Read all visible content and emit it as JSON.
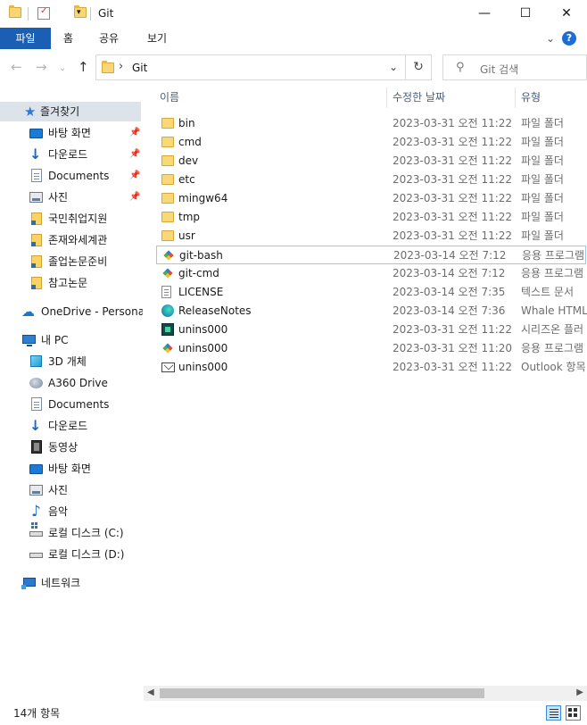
{
  "window": {
    "title": "Git",
    "minimize": "—",
    "maximize": "☐",
    "close": "✕"
  },
  "ribbon": {
    "tabs": [
      "파일",
      "홈",
      "공유",
      "보기"
    ],
    "help": "?"
  },
  "address": {
    "separator": "›",
    "path": "Git",
    "dropdown": "⌄",
    "refresh": "↻"
  },
  "search": {
    "placeholder": "Git 검색"
  },
  "nav": {
    "back": "←",
    "forward": "→",
    "recent": "⌄",
    "up": "↑",
    "quick_access": {
      "label": "즐겨찾기",
      "items": [
        {
          "label": "바탕 화면",
          "pinned": true
        },
        {
          "label": "다운로드",
          "pinned": true
        },
        {
          "label": "Documents",
          "pinned": true
        },
        {
          "label": "사진",
          "pinned": true
        },
        {
          "label": "국민취업지원",
          "pinned": false
        },
        {
          "label": "존재와세계관",
          "pinned": false
        },
        {
          "label": "졸업논문준비",
          "pinned": false
        },
        {
          "label": "참고논문",
          "pinned": false
        }
      ]
    },
    "onedrive": "OneDrive - Personal",
    "this_pc": {
      "label": "내 PC",
      "items": [
        "3D 개체",
        "A360 Drive",
        "Documents",
        "다운로드",
        "동영상",
        "바탕 화면",
        "사진",
        "음악",
        "로컬 디스크 (C:)",
        "로컬 디스크 (D:)"
      ]
    },
    "network": "네트워크"
  },
  "columns": {
    "name": "이름",
    "date": "수정한 날짜",
    "type": "유형",
    "sort_indicator": "^"
  },
  "files": [
    {
      "name": "bin",
      "date": "2023-03-31 오전 11:22",
      "type": "파일 폴더",
      "icon": "folder"
    },
    {
      "name": "cmd",
      "date": "2023-03-31 오전 11:22",
      "type": "파일 폴더",
      "icon": "folder"
    },
    {
      "name": "dev",
      "date": "2023-03-31 오전 11:22",
      "type": "파일 폴더",
      "icon": "folder"
    },
    {
      "name": "etc",
      "date": "2023-03-31 오전 11:22",
      "type": "파일 폴더",
      "icon": "folder"
    },
    {
      "name": "mingw64",
      "date": "2023-03-31 오전 11:22",
      "type": "파일 폴더",
      "icon": "folder"
    },
    {
      "name": "tmp",
      "date": "2023-03-31 오전 11:22",
      "type": "파일 폴더",
      "icon": "folder"
    },
    {
      "name": "usr",
      "date": "2023-03-31 오전 11:22",
      "type": "파일 폴더",
      "icon": "folder"
    },
    {
      "name": "git-bash",
      "date": "2023-03-14 오전 7:12",
      "type": "응용 프로그램",
      "icon": "git-icon"
    },
    {
      "name": "git-cmd",
      "date": "2023-03-14 오전 7:12",
      "type": "응용 프로그램",
      "icon": "git-icon"
    },
    {
      "name": "LICENSE",
      "date": "2023-03-14 오전 7:35",
      "type": "텍스트 문서",
      "icon": "text-document-icon"
    },
    {
      "name": "ReleaseNotes",
      "date": "2023-03-14 오전 7:36",
      "type": "Whale HTML",
      "icon": "whale-browser-icon"
    },
    {
      "name": "unins000",
      "date": "2023-03-31 오전 11:22",
      "type": "시리즈온 플러",
      "icon": "seriesone-icon"
    },
    {
      "name": "unins000",
      "date": "2023-03-31 오전 11:20",
      "type": "응용 프로그램",
      "icon": "git-icon"
    },
    {
      "name": "unins000",
      "date": "2023-03-31 오전 11:22",
      "type": "Outlook 항목",
      "icon": "mail-icon"
    }
  ],
  "status": {
    "item_count": "14개 항목"
  },
  "accent": "#1a5fb4"
}
